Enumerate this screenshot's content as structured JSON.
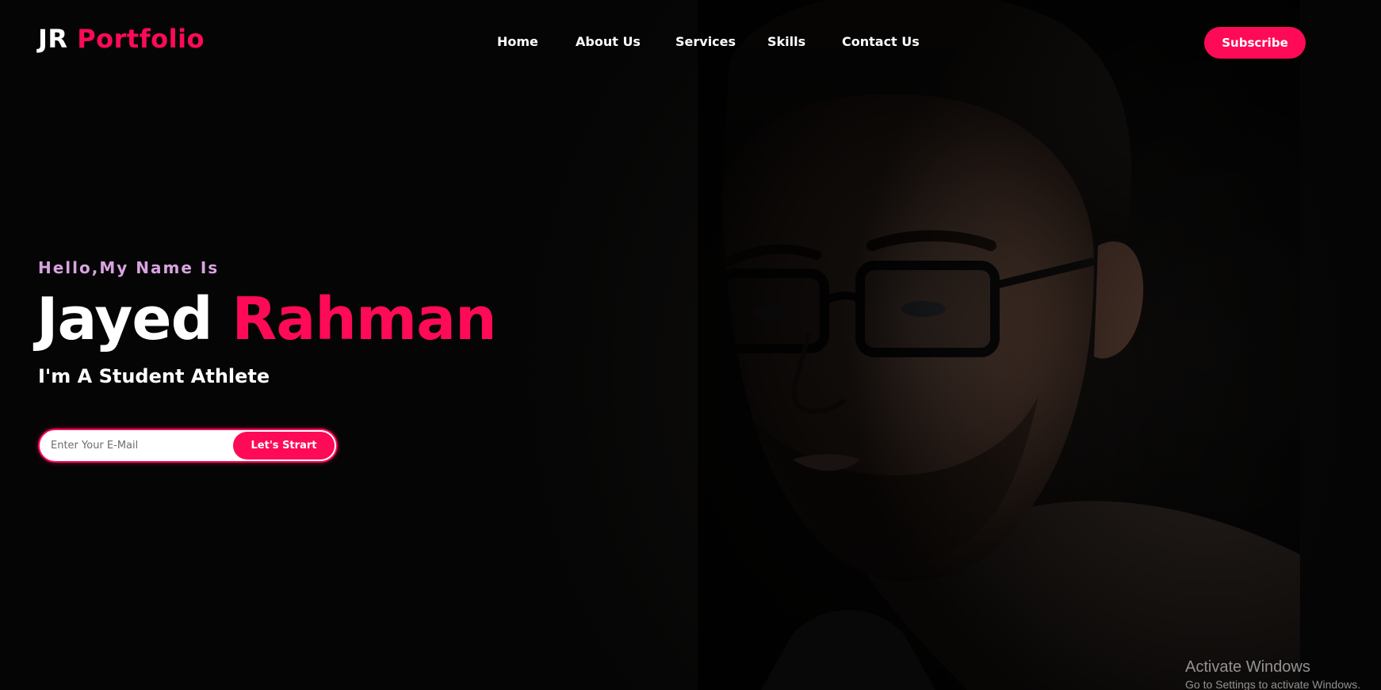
{
  "brand": {
    "first": "JR",
    "second": "Portfolio",
    "accent_color": "#ff0a57"
  },
  "nav": {
    "items": [
      {
        "label": "Home"
      },
      {
        "label": "About Us"
      },
      {
        "label": "Services"
      },
      {
        "label": "Skills"
      },
      {
        "label": "Contact Us"
      }
    ],
    "subscribe_label": "Subscribe"
  },
  "hero": {
    "greeting": "Hello,My Name Is",
    "first_name": "Jayed",
    "last_name": "Rahman",
    "tagline": "I'm A Student Athlete",
    "email_placeholder": "Enter Your E-Mail",
    "cta_label": "Let's Strart",
    "portrait_icon": "man-with-glasses-photo"
  },
  "watermark": {
    "title": "Activate Windows",
    "subtitle": "Go to Settings to activate Windows."
  }
}
